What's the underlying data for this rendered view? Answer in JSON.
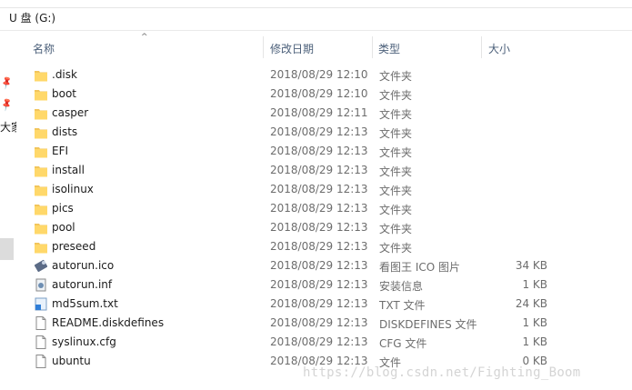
{
  "window": {
    "breadcrumb": "U 盘 (G:)"
  },
  "nav": {
    "truncated_label": "大家"
  },
  "columns": {
    "name": "名称",
    "date": "修改日期",
    "type": "类型",
    "size": "大小"
  },
  "files": [
    {
      "name": ".disk",
      "date": "2018/08/29 12:10",
      "type": "文件夹",
      "size": "",
      "icon": "folder-icon"
    },
    {
      "name": "boot",
      "date": "2018/08/29 12:10",
      "type": "文件夹",
      "size": "",
      "icon": "folder-icon"
    },
    {
      "name": "casper",
      "date": "2018/08/29 12:11",
      "type": "文件夹",
      "size": "",
      "icon": "folder-icon"
    },
    {
      "name": "dists",
      "date": "2018/08/29 12:13",
      "type": "文件夹",
      "size": "",
      "icon": "folder-icon"
    },
    {
      "name": "EFI",
      "date": "2018/08/29 12:13",
      "type": "文件夹",
      "size": "",
      "icon": "folder-icon"
    },
    {
      "name": "install",
      "date": "2018/08/29 12:13",
      "type": "文件夹",
      "size": "",
      "icon": "folder-icon"
    },
    {
      "name": "isolinux",
      "date": "2018/08/29 12:13",
      "type": "文件夹",
      "size": "",
      "icon": "folder-icon"
    },
    {
      "name": "pics",
      "date": "2018/08/29 12:13",
      "type": "文件夹",
      "size": "",
      "icon": "folder-icon"
    },
    {
      "name": "pool",
      "date": "2018/08/29 12:13",
      "type": "文件夹",
      "size": "",
      "icon": "folder-icon"
    },
    {
      "name": "preseed",
      "date": "2018/08/29 12:13",
      "type": "文件夹",
      "size": "",
      "icon": "folder-icon"
    },
    {
      "name": "autorun.ico",
      "date": "2018/08/29 12:13",
      "type": "看图王 ICO 图片",
      "size": "34 KB",
      "icon": "image-file-icon"
    },
    {
      "name": "autorun.inf",
      "date": "2018/08/29 12:13",
      "type": "安装信息",
      "size": "1 KB",
      "icon": "setup-info-icon"
    },
    {
      "name": "md5sum.txt",
      "date": "2018/08/29 12:13",
      "type": "TXT 文件",
      "size": "24 KB",
      "icon": "text-file-icon"
    },
    {
      "name": "README.diskdefines",
      "date": "2018/08/29 12:13",
      "type": "DISKDEFINES 文件",
      "size": "1 KB",
      "icon": "file-icon"
    },
    {
      "name": "syslinux.cfg",
      "date": "2018/08/29 12:13",
      "type": "CFG 文件",
      "size": "1 KB",
      "icon": "file-icon"
    },
    {
      "name": "ubuntu",
      "date": "2018/08/29 12:13",
      "type": "文件",
      "size": "0 KB",
      "icon": "file-icon"
    }
  ],
  "watermark": "https://blog.csdn.net/Fighting_Boom"
}
